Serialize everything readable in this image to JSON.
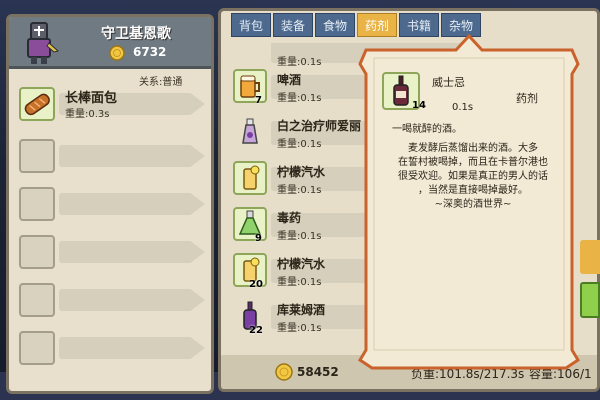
{
  "merchant": {
    "name": "守卫基恩歌",
    "gold": "6732",
    "relation": "关系:普通",
    "items": [
      {
        "name": "长棒面包",
        "weight": "重量:0.3s"
      }
    ]
  },
  "backpack": {
    "tabs": [
      "背包",
      "装备",
      "食物",
      "药剂",
      "书籍",
      "杂物"
    ],
    "active_tab": "药剂",
    "items": [
      {
        "name": "",
        "weight": "重量:0.1s",
        "count": ""
      },
      {
        "name": "啤酒",
        "weight": "重量:0.1s",
        "count": "7"
      },
      {
        "name": "白之治疗师爱丽",
        "weight": "重量:0.1s",
        "count": ""
      },
      {
        "name": "柠檬汽水",
        "weight": "重量:0.1s",
        "count": ""
      },
      {
        "name": "毒药",
        "weight": "重量:0.1s",
        "count": "9"
      },
      {
        "name": "柠檬汽水",
        "weight": "重量:0.1s",
        "count": "20"
      },
      {
        "name": "库莱姆酒",
        "weight": "重量:0.1s",
        "count": "22"
      }
    ],
    "gold": "58452",
    "load": "负重:101.8s/217.3s",
    "capacity": "容量:106/1"
  },
  "tooltip": {
    "name": "威士忌",
    "type": "药剂",
    "count": "14",
    "weight": "0.1s",
    "flavor": "一喝就醉的酒。",
    "description": [
      "麦发酵后蒸馏出来的酒。大多",
      "在誓村被喝掉，而且在卡普尔港也",
      "很受欢迎。如果是真正的男人的话",
      "，当然是直接喝掉最好。",
      "~深奥的酒世界~"
    ]
  },
  "colors": {
    "tab_active": "#e9b346",
    "tab_inactive": "#4d6a8e",
    "slot_filled": "#e8f2c6",
    "parchment": "#f3ead6"
  }
}
